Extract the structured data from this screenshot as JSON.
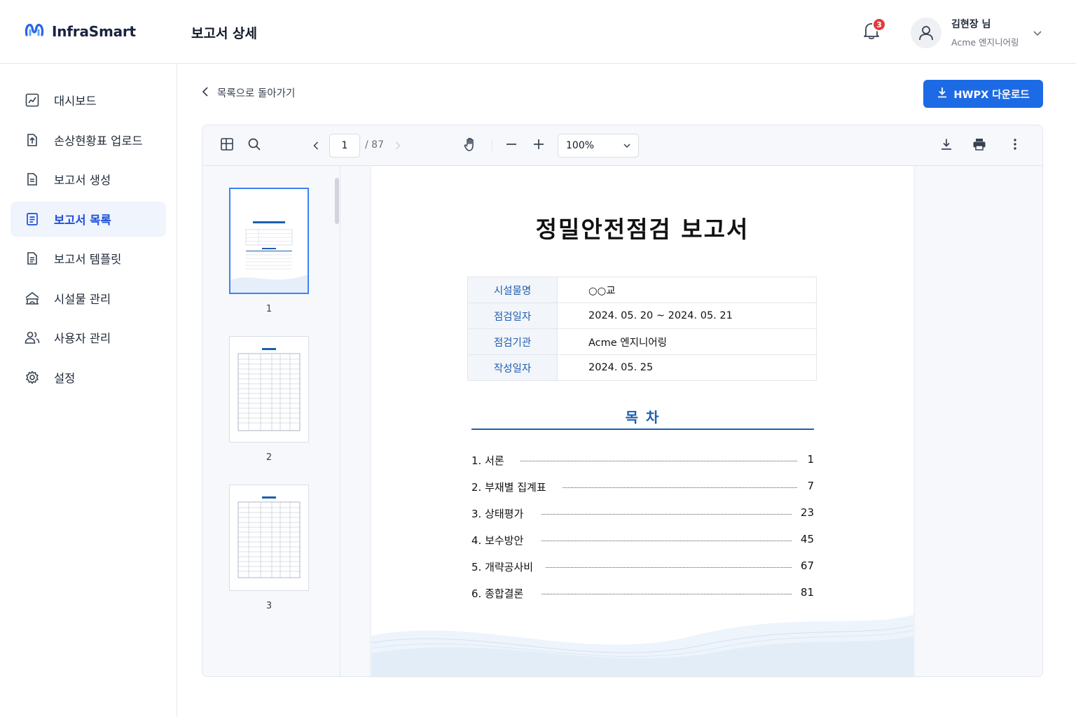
{
  "app": {
    "name": "InfraSmart",
    "page_heading": "보고서 상세",
    "notifications_count": "3",
    "user_name": "김현장 님",
    "user_org": "Acme 엔지니어링"
  },
  "sidebar": {
    "items": [
      {
        "label": "대시보드",
        "icon": "dashboard-icon"
      },
      {
        "label": "손상현황표 업로드",
        "icon": "upload-icon"
      },
      {
        "label": "보고서 생성",
        "icon": "document-create-icon"
      },
      {
        "label": "보고서 목록",
        "icon": "document-list-icon",
        "active": true
      },
      {
        "label": "보고서 템플릿",
        "icon": "template-icon"
      },
      {
        "label": "시설물 관리",
        "icon": "bridge-icon"
      },
      {
        "label": "사용자 관리",
        "icon": "users-icon"
      },
      {
        "label": "설정",
        "icon": "gear-icon"
      }
    ]
  },
  "main": {
    "back_label": "목록으로 돌아가기",
    "download_label": "HWPX 다운로드"
  },
  "viewer": {
    "current_page": "1",
    "total_pages": "/ 87",
    "zoom": "100%",
    "thumbnails": [
      "1",
      "2",
      "3"
    ]
  },
  "document": {
    "title": "정밀안전점검 보고서",
    "info": [
      {
        "key": "시설물명",
        "value": "○○교"
      },
      {
        "key": "점검일자",
        "value": "2024. 05. 20 ~ 2024. 05. 21"
      },
      {
        "key": "점검기관",
        "value": "Acme 엔지니어링"
      },
      {
        "key": "작성일자",
        "value": "2024. 05. 25"
      }
    ],
    "toc_title": "목 차",
    "toc": [
      {
        "label": "1.  서론",
        "page": "1"
      },
      {
        "label": "2.  부재별 집계표",
        "page": "7"
      },
      {
        "label": "3.  상태평가",
        "page": "23"
      },
      {
        "label": "4.  보수방안",
        "page": "45"
      },
      {
        "label": "5.  개략공사비",
        "page": "67"
      },
      {
        "label": "6.  종합결론",
        "page": "81"
      }
    ]
  },
  "colors": {
    "accent": "#1d6ae5",
    "active_nav_bg": "#eff4fd",
    "doc_blue": "#1d5fb0",
    "badge": "#e23b3b"
  }
}
